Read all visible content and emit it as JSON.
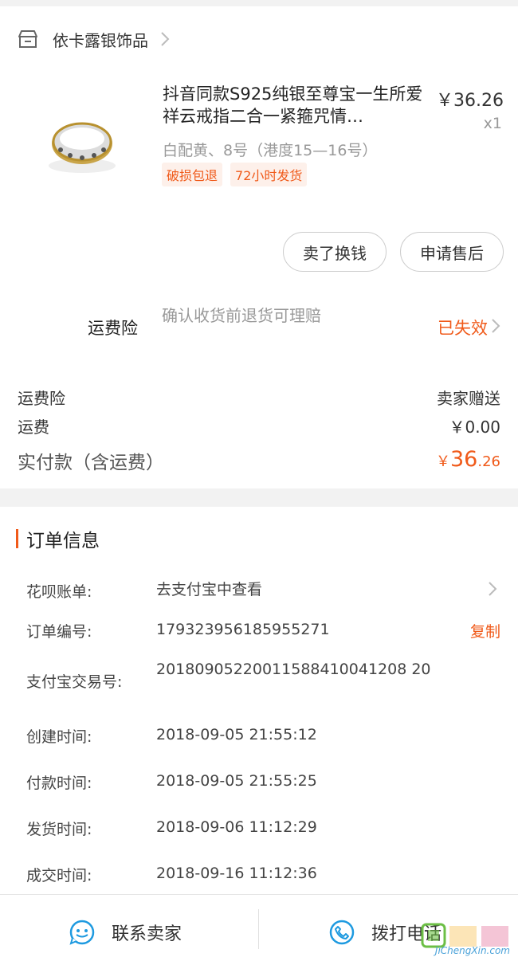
{
  "shop": {
    "name": "依卡露银饰品"
  },
  "product": {
    "title": "抖音同款S925纯银至尊宝一生所爱祥云戒指二合一紧箍咒情…",
    "price": "￥36.26",
    "qty": "x1",
    "spec": "白配黄、8号（港度15—16号）",
    "tags": [
      "破损包退",
      "72小时发货"
    ]
  },
  "actions": {
    "sell_label": "卖了换钱",
    "after_sale_label": "申请售后"
  },
  "insurance": {
    "label": "运费险",
    "desc": "确认收货前退货可理赔",
    "status": "已失效"
  },
  "fees": {
    "ins_label": "运费险",
    "ins_value": "卖家赠送",
    "ship_label": "运费",
    "ship_value": "￥0.00",
    "total_label": "实付款（含运费）",
    "total_currency": "￥",
    "total_int": "36",
    "total_dec": ".26"
  },
  "order_info": {
    "title": "订单信息",
    "huabei_label": "花呗账单:",
    "huabei_value": "去支付宝中查看",
    "order_no_label": "订单编号:",
    "order_no_value": "179323956185955271",
    "copy_label": "复制",
    "alipay_label": "支付宝交易号:",
    "alipay_value": "20180905220011588410041208 20",
    "created_label": "创建时间:",
    "created_value": "2018-09-05 21:55:12",
    "paid_label": "付款时间:",
    "paid_value": "2018-09-05 21:55:25",
    "shipped_label": "发货时间:",
    "shipped_value": "2018-09-06 11:12:29",
    "done_label": "成交时间:",
    "done_value": "2018-09-16 11:12:36"
  },
  "bottom": {
    "contact_label": "联系卖家",
    "call_label": "拨打电话"
  },
  "watermark": {
    "text": "JiChengXin.com"
  },
  "colors": {
    "accent": "#f05a1a",
    "icon_blue": "#1e9ae0"
  }
}
